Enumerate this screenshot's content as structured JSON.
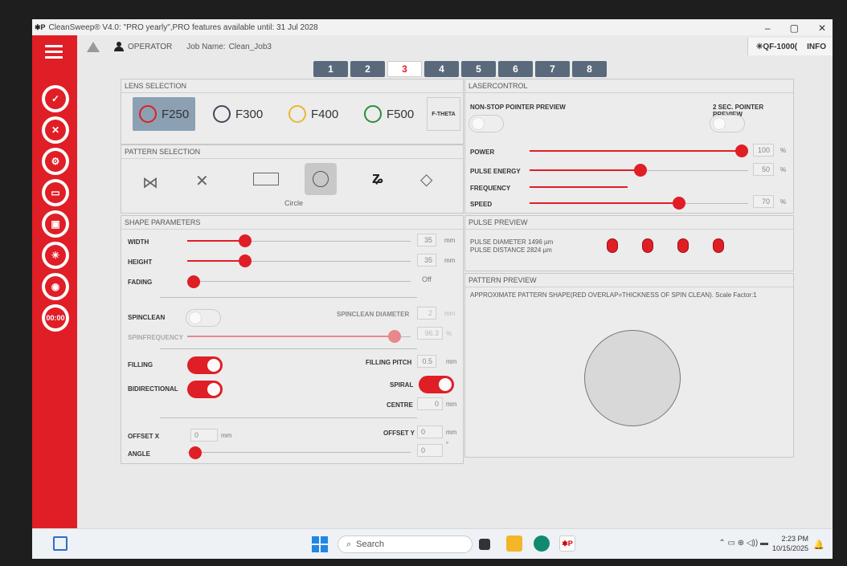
{
  "title_bar": {
    "logo": "✱P",
    "title": "CleanSweep® V4.0: \"PRO yearly\",PRO features available until: 31 Jul 2028",
    "minimize": "–",
    "maximize": "▢",
    "close": "✕"
  },
  "header": {
    "operator": "OPERATOR",
    "job_name_label": "Job Name:",
    "job_name": "Clean_Job3",
    "device": "✳QF-1000(",
    "info": "INFO"
  },
  "sidebar": {
    "timer": "00:00",
    "icons": [
      "hamburger-menu-icon",
      "document-check-icon",
      "document-delete-icon",
      "gear-icon",
      "folder-icon",
      "save-icon",
      "laser-icon",
      "eye-icon"
    ]
  },
  "tabs": [
    "1",
    "2",
    "3",
    "4",
    "5",
    "6",
    "7",
    "8"
  ],
  "active_tab": "3",
  "lens_selection": {
    "title": "LENS SELECTION",
    "lenses": [
      "F250",
      "F300",
      "F400",
      "F500"
    ],
    "ftheta": "F-THETA",
    "selected": "F250",
    "colors": [
      "#e01e26",
      "#444a5c",
      "#e8b830",
      "#2e8b3c"
    ]
  },
  "pattern_selection": {
    "title": "PATTERN SELECTION",
    "patterns": [
      "bowtie-pattern-icon",
      "cross-pattern-icon",
      "rectangle-pattern-icon",
      "circle-pattern-icon",
      "spiral-pattern-icon",
      "shape-pattern-icon"
    ],
    "selected_label": "Circle"
  },
  "shape_parameters": {
    "title": "SHAPE PARAMETERS",
    "width": {
      "label": "WIDTH",
      "value": "35",
      "unit": "mm",
      "level": 0.25
    },
    "height": {
      "label": "HEIGHT",
      "value": "35",
      "unit": "mm",
      "level": 0.25
    },
    "fading": {
      "label": "FADING",
      "value": "Off",
      "level": 0.0
    },
    "spinclean": {
      "label": "SPINCLEAN",
      "on": false
    },
    "spinclean_diameter": {
      "label": "SPINCLEAN DIAMETER",
      "value": "2",
      "unit": "mm"
    },
    "spinfrequency": {
      "label": "SPINFREQUENCY",
      "value": "96.3",
      "unit": "%",
      "level": 0.96
    },
    "filling": {
      "label": "FILLING",
      "on": true
    },
    "filling_pitch": {
      "label": "FILLING PITCH",
      "value": "0.5",
      "unit": "mm"
    },
    "bidirectional": {
      "label": "BIDIRECTIONAL",
      "on": true
    },
    "spiral": {
      "label": "SPIRAL",
      "on": true
    },
    "centre": {
      "label": "CENTRE",
      "value": "0",
      "unit": "mm"
    },
    "offset_x": {
      "label": "OFFSET X",
      "value": "0",
      "unit": "mm"
    },
    "offset_y": {
      "label": "OFFSET Y",
      "value": "0",
      "unit": "mm"
    },
    "angle": {
      "label": "ANGLE",
      "value": "0",
      "unit": "°",
      "level": 0.0
    }
  },
  "laser_control": {
    "title": "LASERCONTROL",
    "nonstop": {
      "label": "NON-STOP POINTER PREVIEW",
      "on": false
    },
    "two_sec": {
      "label": "2 SEC. POINTER PREVIEW",
      "on": false
    },
    "power": {
      "label": "POWER",
      "value": "100",
      "unit": "%",
      "level": 1.0
    },
    "pulse_energy": {
      "label": "PULSE ENERGY",
      "value": "50",
      "unit": "%",
      "level": 0.5
    },
    "frequency": {
      "label": "FREQUENCY",
      "level": 0.45
    },
    "speed": {
      "label": "SPEED",
      "value": "70",
      "unit": "%",
      "level": 0.7
    }
  },
  "pulse_preview": {
    "title": "PULSE PREVIEW",
    "diameter": "PULSE DIAMETER 1496 µm",
    "distance": "PULSE DISTANCE 2824 µm"
  },
  "pattern_preview": {
    "title": "PATTERN PREVIEW",
    "caption": "APPROXIMATE PATTERN SHAPE(RED OVERLAP=THICKNESS OF SPIN CLEAN). Scale Factor:1"
  },
  "taskbar": {
    "search": "Search",
    "time": "2:23 PM",
    "date": "10/15/2025",
    "app_label": "✱P"
  }
}
